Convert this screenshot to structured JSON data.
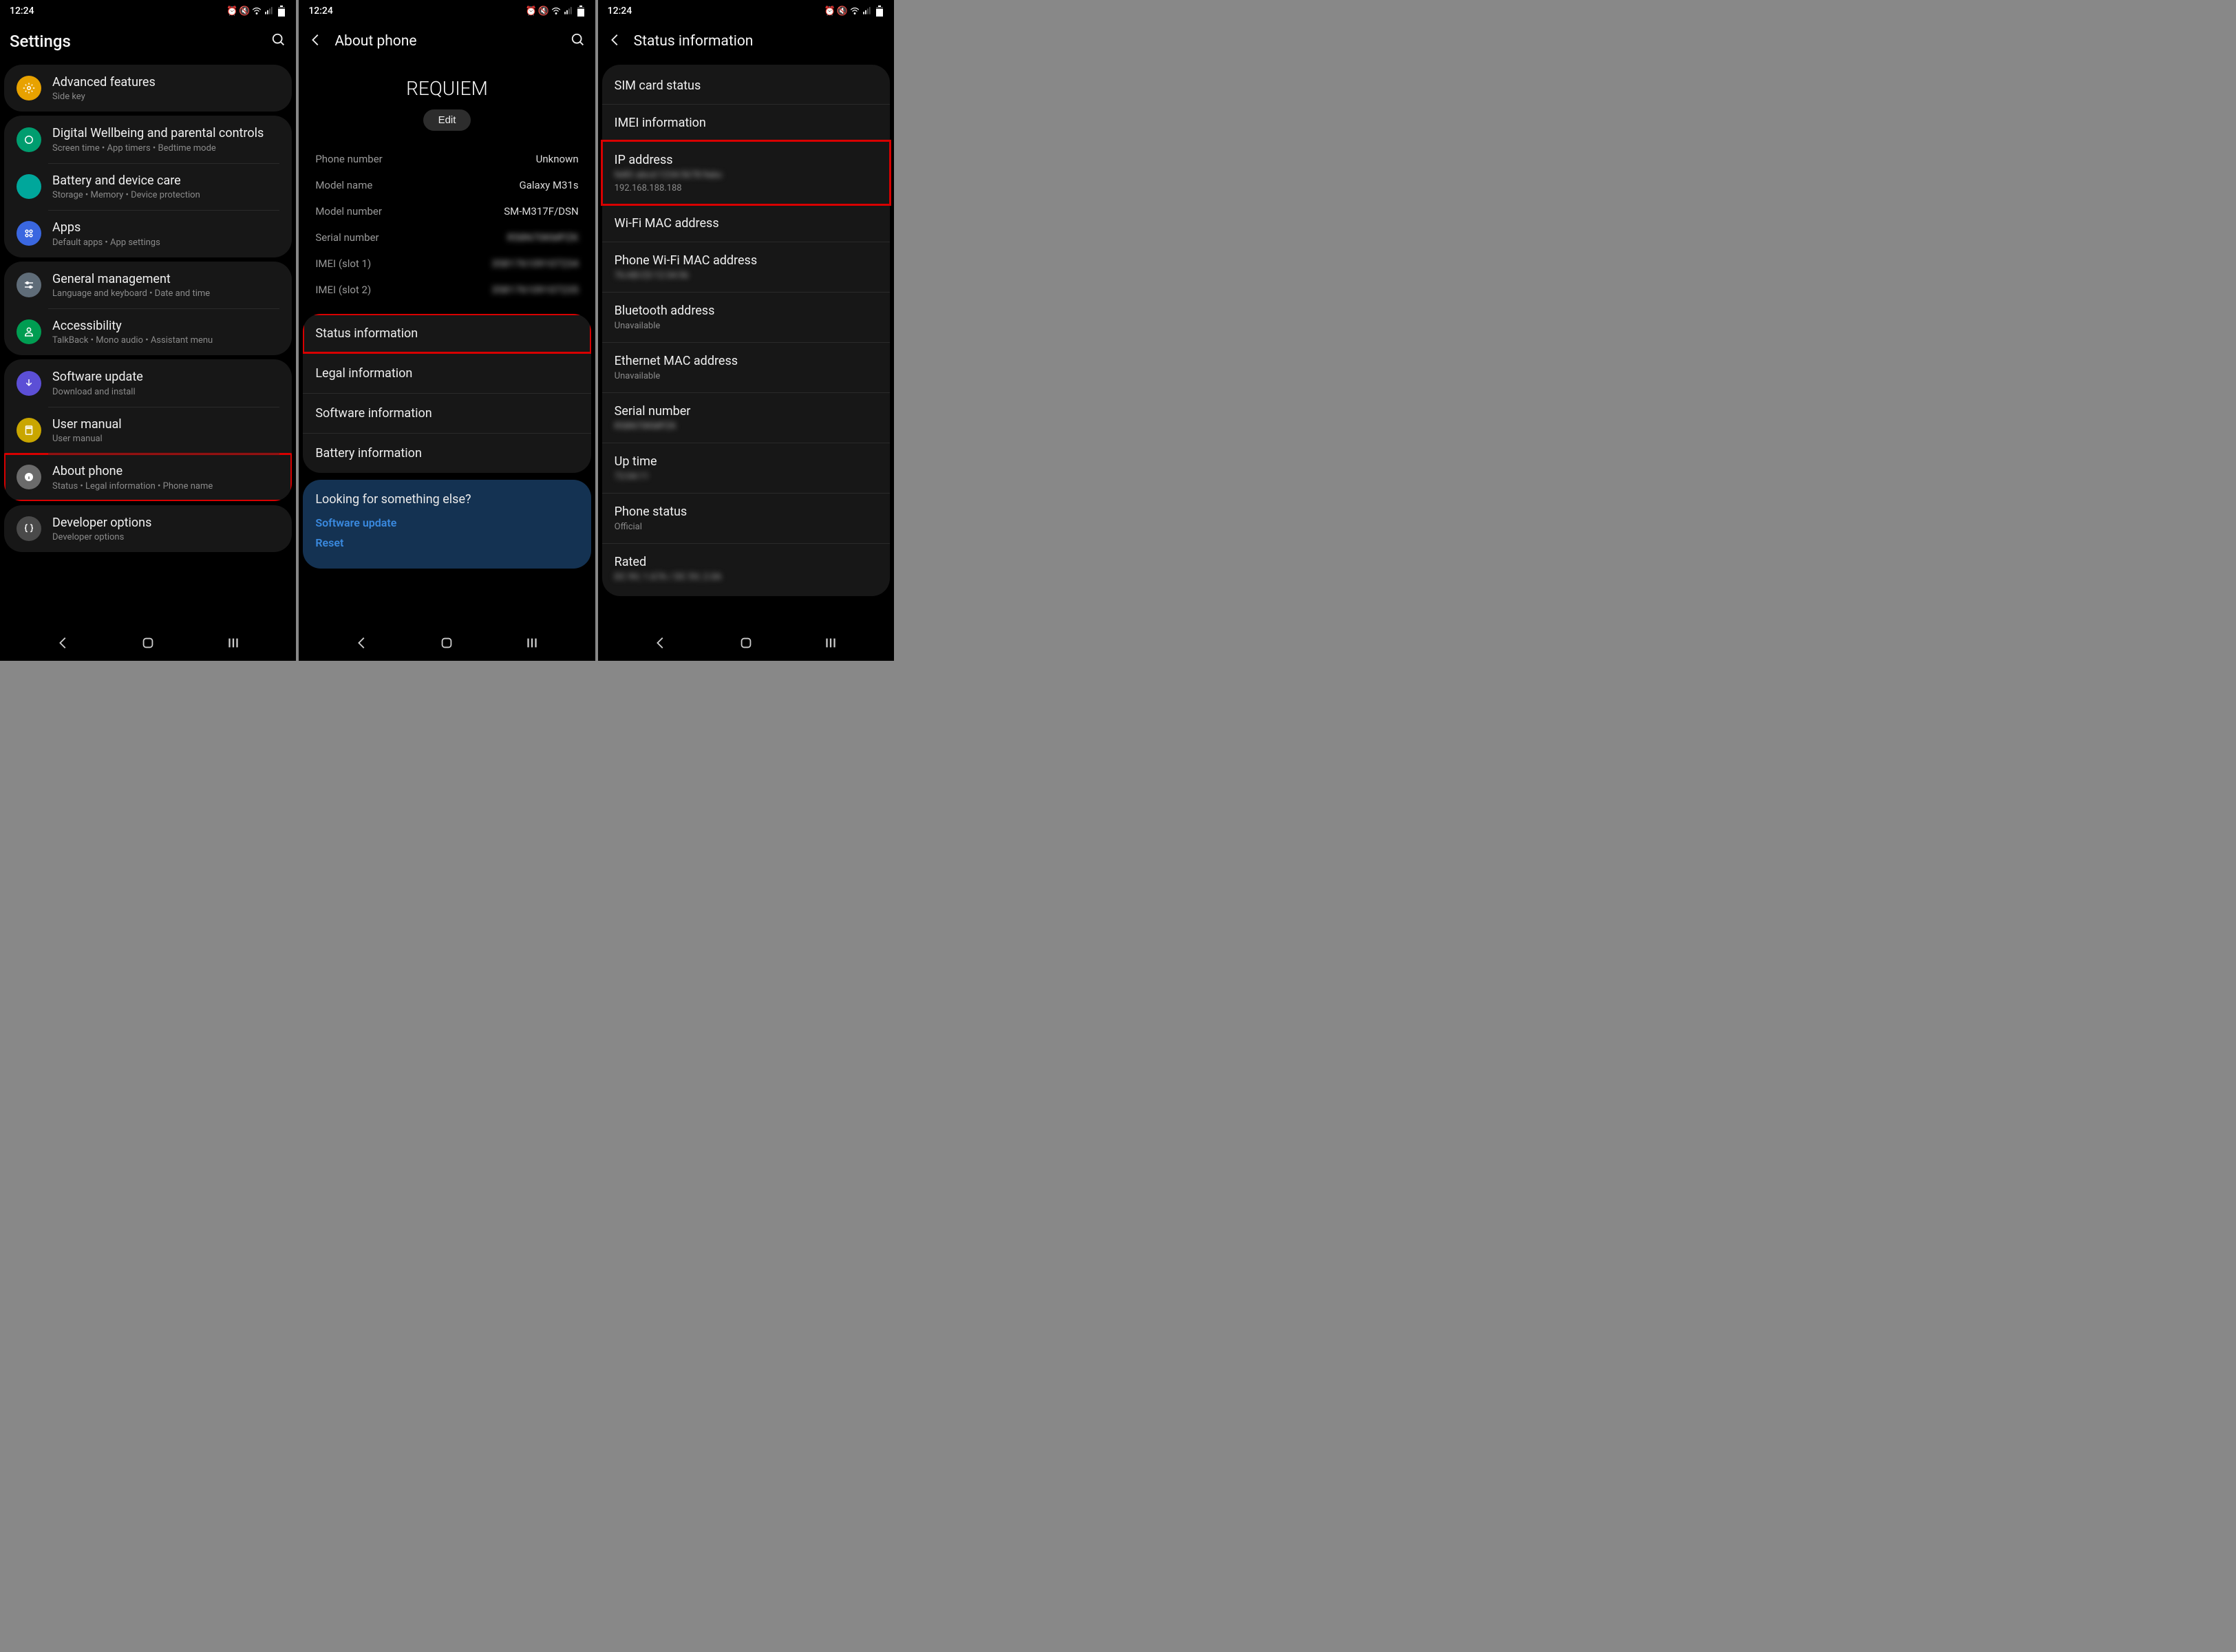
{
  "status_time": "12:24",
  "screen1": {
    "title": "Settings",
    "groups": [
      [
        {
          "icon_bg": "#e8a200",
          "icon": "gear",
          "title": "Advanced features",
          "sub": "Side key"
        }
      ],
      [
        {
          "icon_bg": "#009d6f",
          "icon": "circle",
          "title": "Digital Wellbeing and parental controls",
          "sub": "Screen time  •  App timers  •  Bedtime mode"
        },
        {
          "icon_bg": "#00a79b",
          "icon": "heart",
          "title": "Battery and device care",
          "sub": "Storage  •  Memory  •  Device protection"
        },
        {
          "icon_bg": "#3a67e0",
          "icon": "grid",
          "title": "Apps",
          "sub": "Default apps  •  App settings"
        }
      ],
      [
        {
          "icon_bg": "#5f6c78",
          "icon": "sliders",
          "title": "General management",
          "sub": "Language and keyboard  •  Date and time"
        },
        {
          "icon_bg": "#009d52",
          "icon": "person",
          "title": "Accessibility",
          "sub": "TalkBack  •  Mono audio  •  Assistant menu"
        }
      ],
      [
        {
          "icon_bg": "#5c4fd6",
          "icon": "down",
          "title": "Software update",
          "sub": "Download and install"
        },
        {
          "icon_bg": "#c9a600",
          "icon": "book",
          "title": "User manual",
          "sub": "User manual"
        },
        {
          "icon_bg": "#6b6b6b",
          "icon": "info",
          "title": "About phone",
          "sub": "Status  •  Legal information  •  Phone name",
          "highlight": true
        }
      ],
      [
        {
          "icon_bg": "#4a4a4a",
          "icon": "braces",
          "title": "Developer options",
          "sub": "Developer options"
        }
      ]
    ]
  },
  "screen2": {
    "title": "About phone",
    "device_name": "REQUIEM",
    "edit_label": "Edit",
    "kv": [
      {
        "k": "Phone number",
        "v": "Unknown"
      },
      {
        "k": "Model name",
        "v": "Galaxy M31s"
      },
      {
        "k": "Model number",
        "v": "SM-M317F/DSN"
      },
      {
        "k": "Serial number",
        "v": "R58N70KMPZK",
        "blur": true
      },
      {
        "k": "IMEI (slot 1)",
        "v": "358176109107234",
        "blur": true
      },
      {
        "k": "IMEI (slot 2)",
        "v": "358176109107235",
        "blur": true
      }
    ],
    "links": [
      {
        "label": "Status information",
        "highlight": true
      },
      {
        "label": "Legal information"
      },
      {
        "label": "Software information"
      },
      {
        "label": "Battery information"
      }
    ],
    "suggest_title": "Looking for something else?",
    "suggest_links": [
      "Software update",
      "Reset"
    ]
  },
  "screen3": {
    "title": "Status information",
    "items": [
      {
        "title": "SIM card status"
      },
      {
        "title": "IMEI information"
      },
      {
        "title": "IP address",
        "sub_blur": "fe80::abcd:1234:5678:9abc",
        "sub": "192.168.188.188",
        "highlight": true
      },
      {
        "title": "Wi-Fi MAC address"
      },
      {
        "title": "Phone Wi-Fi MAC address",
        "sub_blur": "76:AB:CD:12:34:56"
      },
      {
        "title": "Bluetooth address",
        "sub": "Unavailable"
      },
      {
        "title": "Ethernet MAC address",
        "sub": "Unavailable"
      },
      {
        "title": "Serial number",
        "sub_blur": "R58N70KMPZK"
      },
      {
        "title": "Up time",
        "sub_blur": "72:04:11"
      },
      {
        "title": "Phone status",
        "sub": "Official"
      },
      {
        "title": "Rated",
        "sub_blur": "DC 9V; 1.67A / DC 5V; 2.0A"
      }
    ]
  }
}
